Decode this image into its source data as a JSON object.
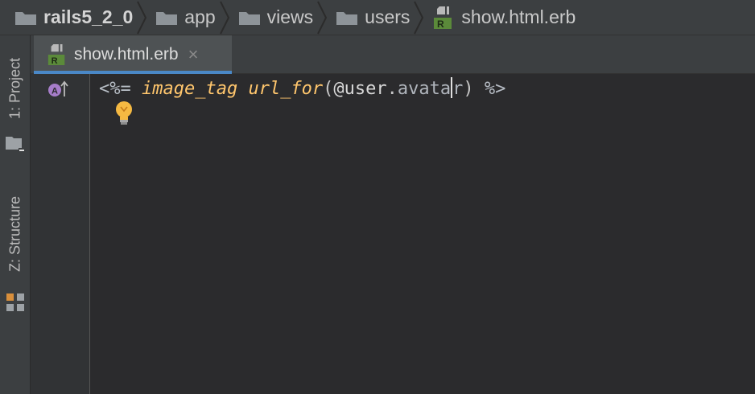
{
  "breadcrumb": [
    {
      "label": "rails5_2_0",
      "icon": "folder-icon"
    },
    {
      "label": "app",
      "icon": "folder-icon"
    },
    {
      "label": "views",
      "icon": "folder-icon"
    },
    {
      "label": "users",
      "icon": "folder-icon"
    },
    {
      "label": "show.html.erb",
      "icon": "erb-file-icon"
    }
  ],
  "tool_windows": {
    "project": {
      "label": "1: Project"
    },
    "structure": {
      "label": "Z: Structure"
    }
  },
  "tab": {
    "label": "show.html.erb",
    "close_glyph": "×",
    "icon": "erb-file-icon"
  },
  "file_icon": {
    "badge": "R",
    "badge_color": "#5b8a3a"
  },
  "gutter": {
    "marker_letter": "A",
    "marker_color": "#a67dc9"
  },
  "editor": {
    "tokens": {
      "open_tag": "<%= ",
      "method1": "image_tag",
      "space": " ",
      "method2": "url_for",
      "open_paren": "(",
      "ivar": "@user",
      "dot": ".",
      "attr_before_caret": "avata",
      "attr_after_caret": "r",
      "close_paren": ")",
      "close_tag": " %>"
    },
    "intention": "lightbulb-icon"
  },
  "colors": {
    "accent": "#4a88c7",
    "method": "#ffc66d",
    "background": "#2b2b2d",
    "chrome": "#3c3f41"
  }
}
